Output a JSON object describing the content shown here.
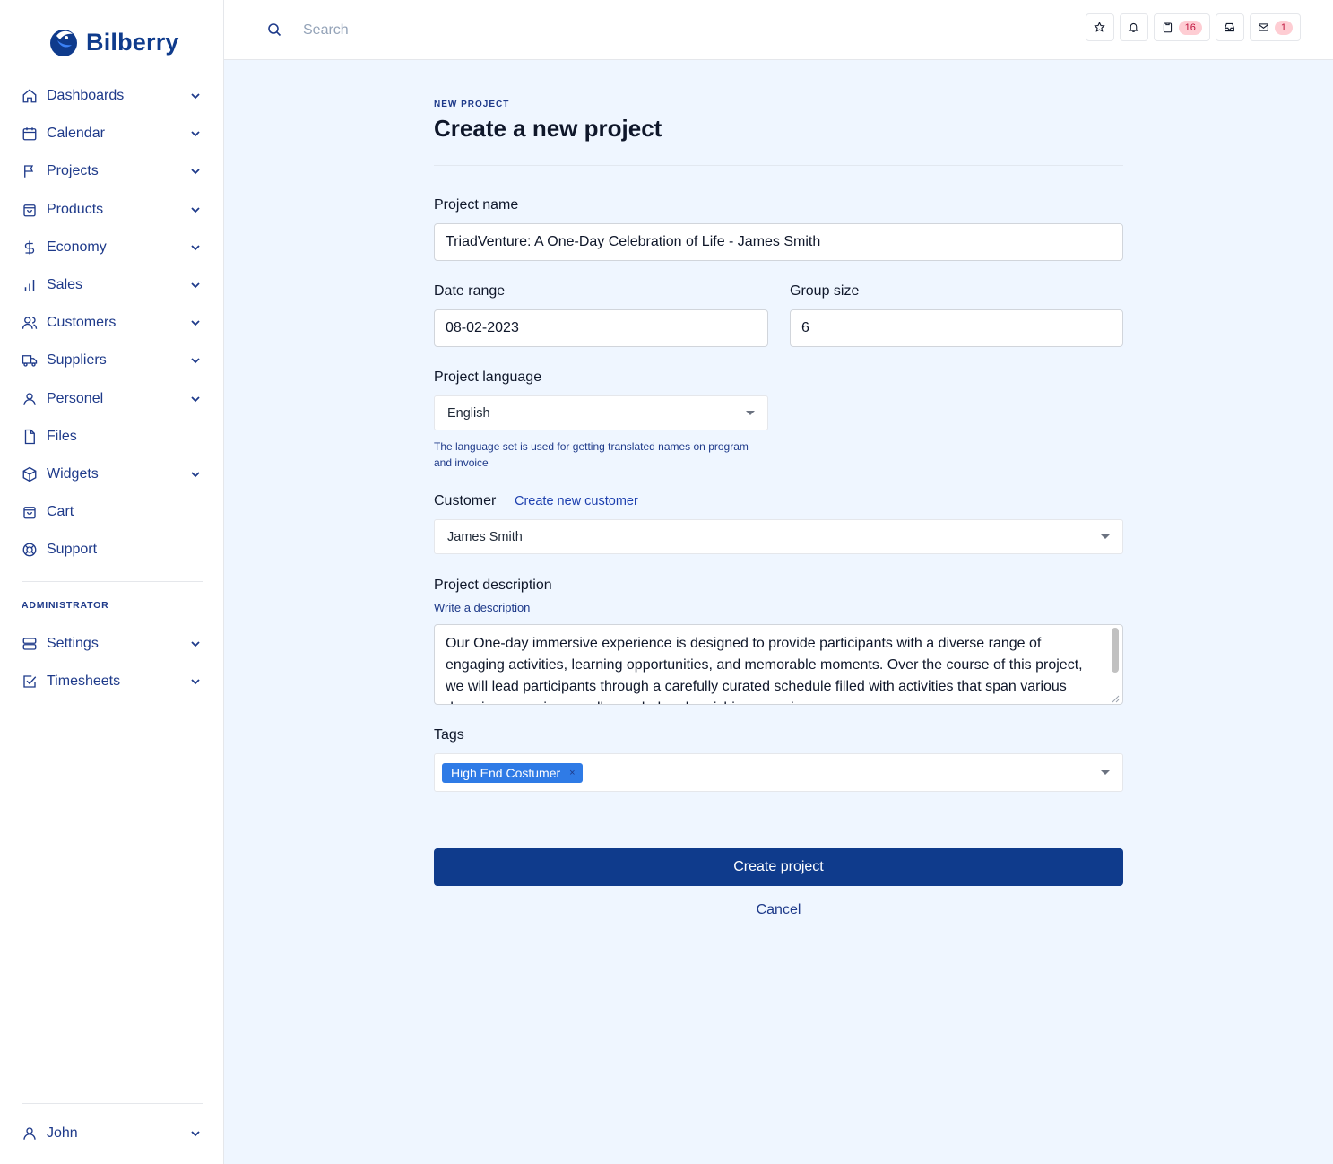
{
  "brand": {
    "name": "Bilberry"
  },
  "sidebar": {
    "items": [
      {
        "label": "Dashboards",
        "icon": "home-icon",
        "expandable": true
      },
      {
        "label": "Calendar",
        "icon": "calendar-icon",
        "expandable": true
      },
      {
        "label": "Projects",
        "icon": "flag-icon",
        "expandable": true
      },
      {
        "label": "Products",
        "icon": "shopping-bag-icon",
        "expandable": true
      },
      {
        "label": "Economy",
        "icon": "dollar-icon",
        "expandable": true
      },
      {
        "label": "Sales",
        "icon": "bar-chart-icon",
        "expandable": true
      },
      {
        "label": "Customers",
        "icon": "users-icon",
        "expandable": true
      },
      {
        "label": "Suppliers",
        "icon": "truck-icon",
        "expandable": true
      },
      {
        "label": "Personel",
        "icon": "user-icon",
        "expandable": true
      },
      {
        "label": "Files",
        "icon": "file-icon",
        "expandable": false
      },
      {
        "label": "Widgets",
        "icon": "cube-icon",
        "expandable": true
      },
      {
        "label": "Cart",
        "icon": "cart-icon",
        "expandable": false
      },
      {
        "label": "Support",
        "icon": "lifebuoy-icon",
        "expandable": false
      }
    ],
    "admin_label": "ADMINISTRATOR",
    "admin_items": [
      {
        "label": "Settings",
        "icon": "server-icon",
        "expandable": true
      },
      {
        "label": "Timesheets",
        "icon": "checkbox-icon",
        "expandable": true
      }
    ],
    "user": {
      "name": "John",
      "icon": "user-icon"
    }
  },
  "topbar": {
    "search_placeholder": "Search",
    "buttons": [
      {
        "icon": "star-icon"
      },
      {
        "icon": "bell-icon"
      },
      {
        "icon": "clipboard-icon",
        "badge": "16"
      },
      {
        "icon": "inbox-icon"
      },
      {
        "icon": "mail-icon",
        "badge": "1"
      }
    ]
  },
  "form": {
    "eyebrow": "NEW PROJECT",
    "title": "Create a new project",
    "project_name_label": "Project name",
    "project_name_value": "TriadVenture: A One-Day Celebration of Life - James Smith",
    "date_range_label": "Date range",
    "date_range_value": "08-02-2023",
    "group_size_label": "Group size",
    "group_size_value": "6",
    "language_label": "Project language",
    "language_value": "English",
    "language_help": "The language set is used for getting translated names on program and invoice",
    "customer_label": "Customer",
    "create_customer_link": "Create new customer",
    "customer_value": "James Smith",
    "description_label": "Project description",
    "description_help": "Write a description",
    "description_value": "Our One-day immersive experience is designed to provide participants with a diverse range of engaging activities, learning opportunities, and memorable moments. Over the course of this project, we will lead participants through a carefully curated schedule filled with activities that span various domains, ensuring a well-rounded and enriching experience.",
    "tags_label": "Tags",
    "tags": [
      "High End Costumer"
    ],
    "tag_remove_symbol": "×",
    "submit_label": "Create project",
    "cancel_label": "Cancel"
  }
}
